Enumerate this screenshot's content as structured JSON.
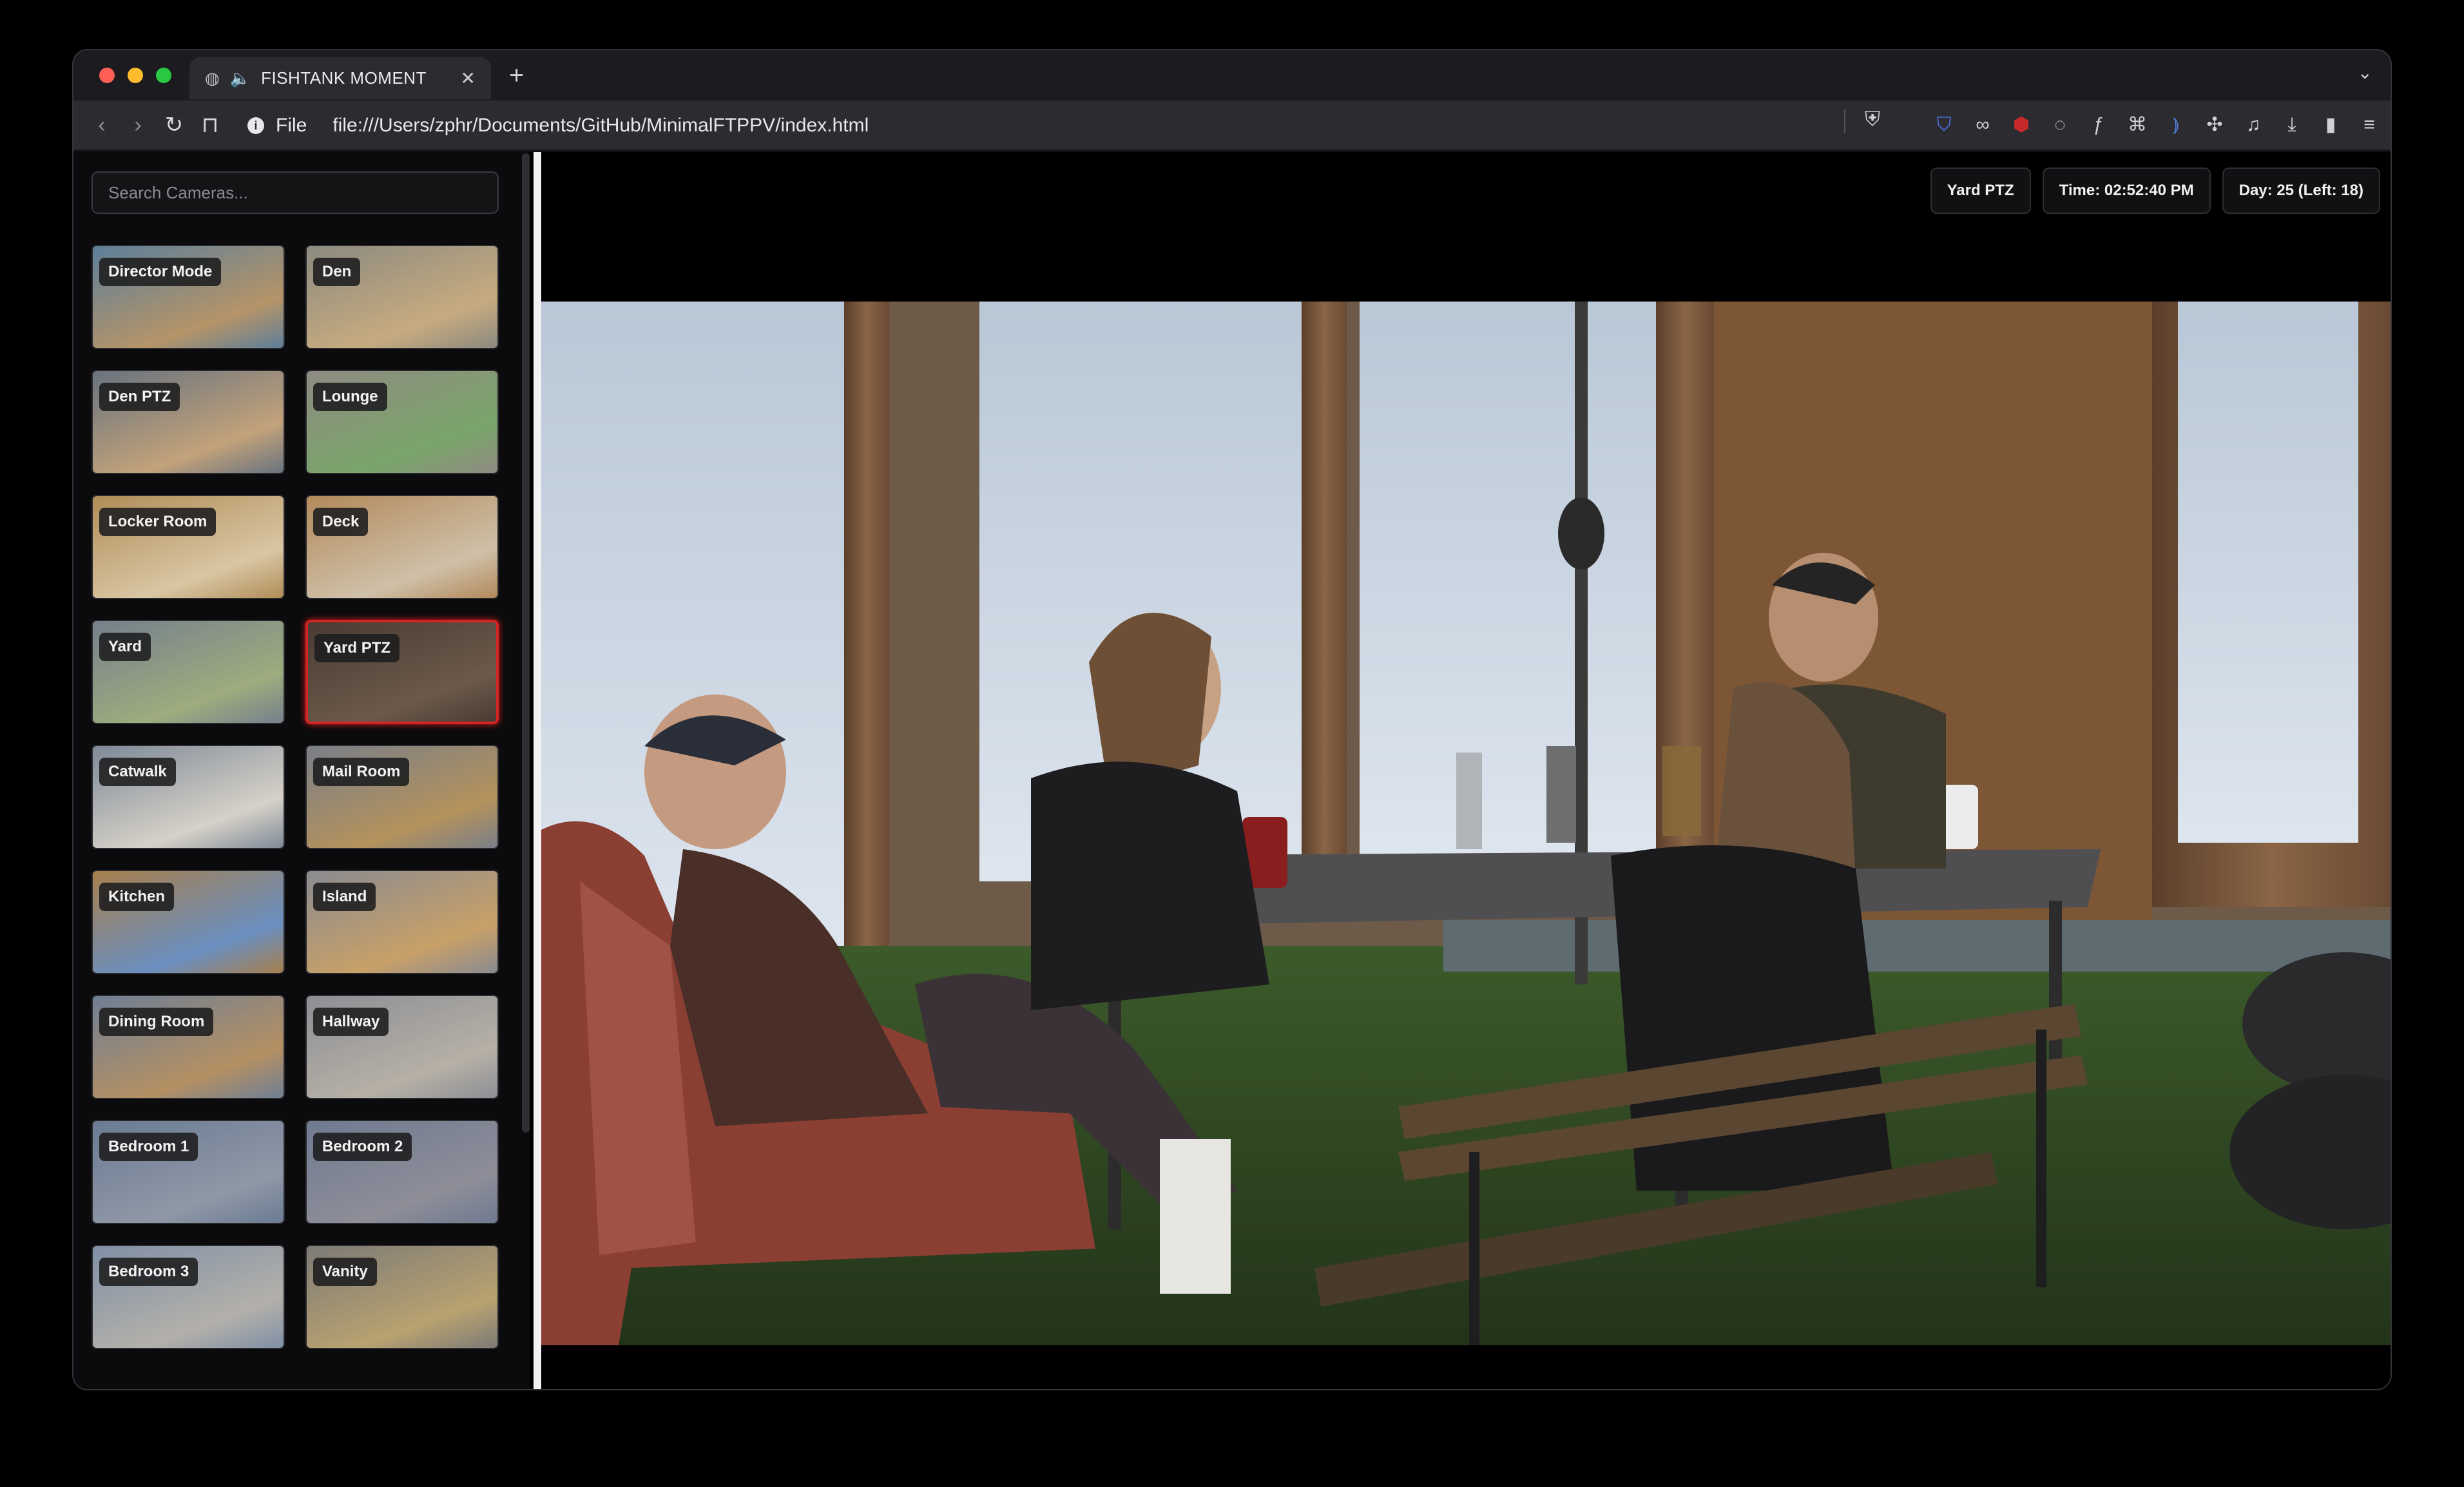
{
  "browser": {
    "tab_title": "FISHTANK MOMENT",
    "scheme_label": "File",
    "url": "file:///Users/zphr/Documents/GitHub/MinimalFTPPV/index.html"
  },
  "sidebar": {
    "search_placeholder": "Search Cameras...",
    "selected_camera": "Yard PTZ",
    "cameras": [
      "Director Mode",
      "Den",
      "Den PTZ",
      "Lounge",
      "Locker Room",
      "Deck",
      "Yard",
      "Yard PTZ",
      "Catwalk",
      "Mail Room",
      "Kitchen",
      "Island",
      "Dining Room",
      "Hallway",
      "Bedroom 1",
      "Bedroom 2",
      "Bedroom 3",
      "Vanity"
    ]
  },
  "header": {
    "camera": "Yard PTZ",
    "time": "Time: 02:52:40 PM",
    "day": "Day: 25 (Left: 18)"
  },
  "icons": {
    "back": "chevron-left-icon",
    "forward": "chevron-right-icon",
    "reload": "reload-icon",
    "bookmark": "bookmark-icon",
    "shield": "brave-shield-icon"
  }
}
